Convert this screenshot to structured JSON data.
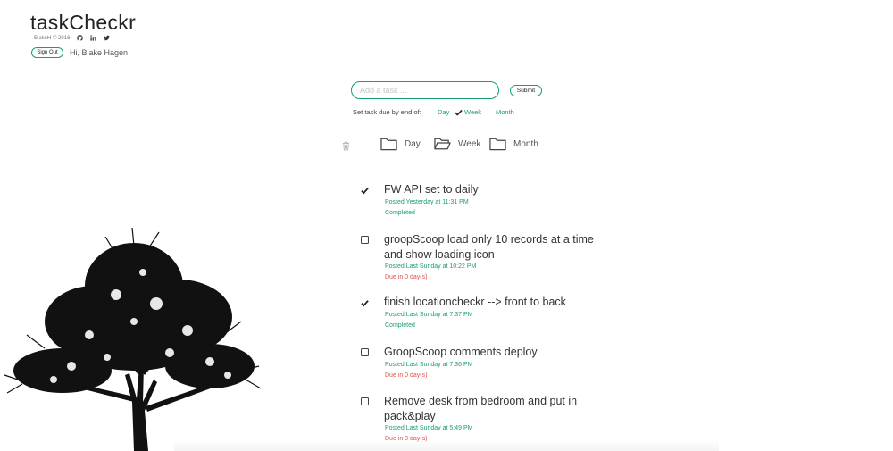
{
  "app": {
    "title": "taskCheckr",
    "copyright": "BlakeH © 2016",
    "social_icons": [
      "github-icon",
      "linkedin-icon",
      "twitter-icon"
    ],
    "sign_out_label": "Sign Out",
    "greeting": "Hi, Blake Hagen"
  },
  "form": {
    "placeholder": "Add a task ...",
    "submit_label": "Submit",
    "due_label": "Set task due by end of:",
    "options": [
      {
        "label": "Day",
        "selected": false
      },
      {
        "label": "Week",
        "selected": true
      },
      {
        "label": "Month",
        "selected": false
      }
    ]
  },
  "filters": {
    "trash_icon": "trash-icon",
    "folders": [
      {
        "label": "Day",
        "icon": "folder-icon",
        "open": false
      },
      {
        "label": "Week",
        "icon": "folder-open-icon",
        "open": true
      },
      {
        "label": "Month",
        "icon": "folder-icon",
        "open": false
      }
    ]
  },
  "tasks": [
    {
      "title": "FW API set to daily",
      "posted": "Posted Yesterday at 11:31 PM",
      "status": "Completed",
      "done": true
    },
    {
      "title": "groopScoop load only 10 records at a time and show loading icon",
      "posted": "Posted Last Sunday at 10:22 PM",
      "status": "Due in 0 day(s)",
      "done": false
    },
    {
      "title": "finish locationcheckr --> front to back",
      "posted": "Posted Last Sunday at 7:37 PM",
      "status": "Completed",
      "done": true
    },
    {
      "title": "GroopScoop comments deploy",
      "posted": "Posted Last Sunday at 7:36 PM",
      "status": "Due in 0 day(s)",
      "done": false
    },
    {
      "title": "Remove desk from bedroom and put in pack&play",
      "posted": "Posted Last Sunday at 5:49 PM",
      "status": "Due in 0 day(s)",
      "done": false
    }
  ],
  "colors": {
    "accent": "#1a9e6e",
    "due": "#e05050",
    "text": "#333333"
  }
}
